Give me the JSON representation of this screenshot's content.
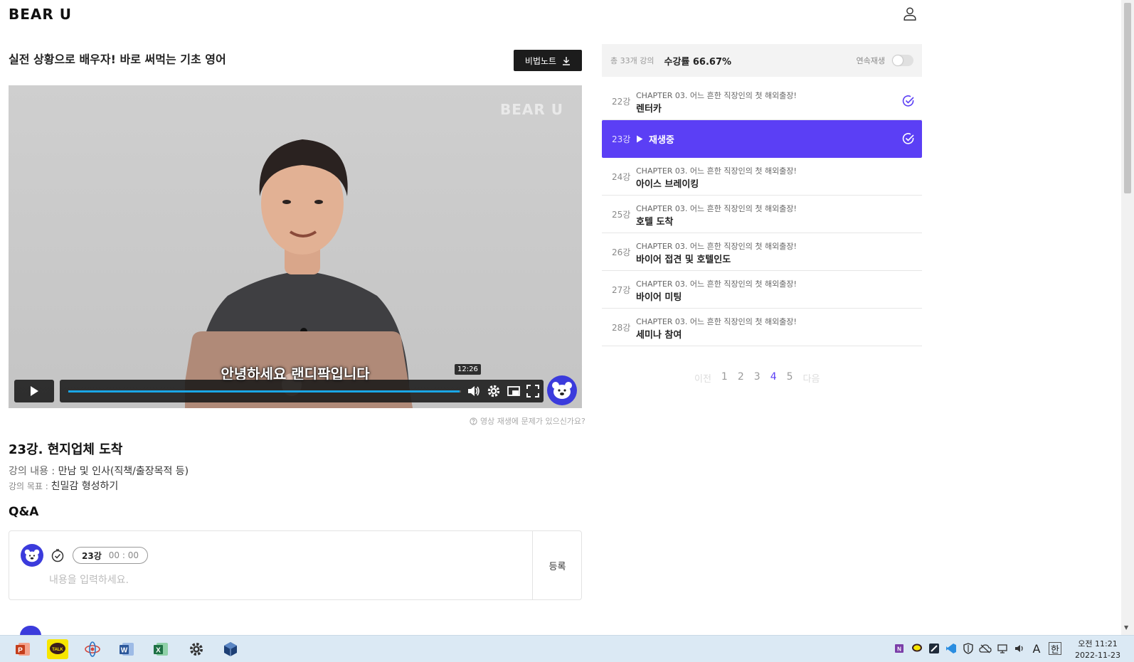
{
  "header": {
    "logo_text": "BEAR U",
    "user_icon": "user-icon"
  },
  "course": {
    "title": "실전 상황으로 배우자! 바로 써먹는 기초 영어",
    "note_button_label": "비법노트"
  },
  "video": {
    "watermark": "BEAR U",
    "subtitle": "안녕하세요 랜디팍입니다",
    "time_tooltip": "12:26",
    "progress_fraction": 0.997,
    "issue_link": "영상 재생에 문제가 있으신가요?"
  },
  "lecture": {
    "title": "23강. 현지업체 도착",
    "content_label": "강의 내용 : ",
    "content_value": "만남 및 인사(직책/출장목적 등)",
    "goal_label": "강의 목표 : ",
    "goal_value": "친밀감 형성하기"
  },
  "qa": {
    "title": "Q&A",
    "pill_lecture": "23강",
    "pill_time": "00 : 00",
    "placeholder": "내용을 입력하세요.",
    "submit_label": "등록"
  },
  "panel": {
    "total": "총 33개 강의",
    "rate": "수강률 66.67%",
    "autoplay_label": "연속재생",
    "autoplay_on": false
  },
  "lessons": [
    {
      "num": "22강",
      "chapter": "CHAPTER 03. 어느 흔한 직장인의 첫 해외출장!",
      "name": "렌터카",
      "done": true
    },
    {
      "num": "23강",
      "now_label": "재생중",
      "done": true,
      "active": true
    },
    {
      "num": "24강",
      "chapter": "CHAPTER 03. 어느 흔한 직장인의 첫 해외출장!",
      "name": "아이스 브레이킹"
    },
    {
      "num": "25강",
      "chapter": "CHAPTER 03. 어느 흔한 직장인의 첫 해외출장!",
      "name": "호텔 도착"
    },
    {
      "num": "26강",
      "chapter": "CHAPTER 03. 어느 흔한 직장인의 첫 해외출장!",
      "name": "바이어 접견 및 호텔인도"
    },
    {
      "num": "27강",
      "chapter": "CHAPTER 03. 어느 흔한 직장인의 첫 해외출장!",
      "name": "바이어 미팅"
    },
    {
      "num": "28강",
      "chapter": "CHAPTER 03. 어느 흔한 직장인의 첫 해외출장!",
      "name": "세미나 참여"
    }
  ],
  "pager": {
    "prev": "이전",
    "pages": [
      "1",
      "2",
      "3",
      "4",
      "5"
    ],
    "current": "4",
    "next": "다음"
  },
  "taskbar": {
    "clock_ampm_time": "오전 11:21",
    "clock_date": "2022-11-23",
    "ime_letter": "A",
    "ime_lang": "한"
  },
  "colors": {
    "accent": "#5b3ff5",
    "progress": "#1aa6e6",
    "bear_blue": "#3b3bdc"
  }
}
